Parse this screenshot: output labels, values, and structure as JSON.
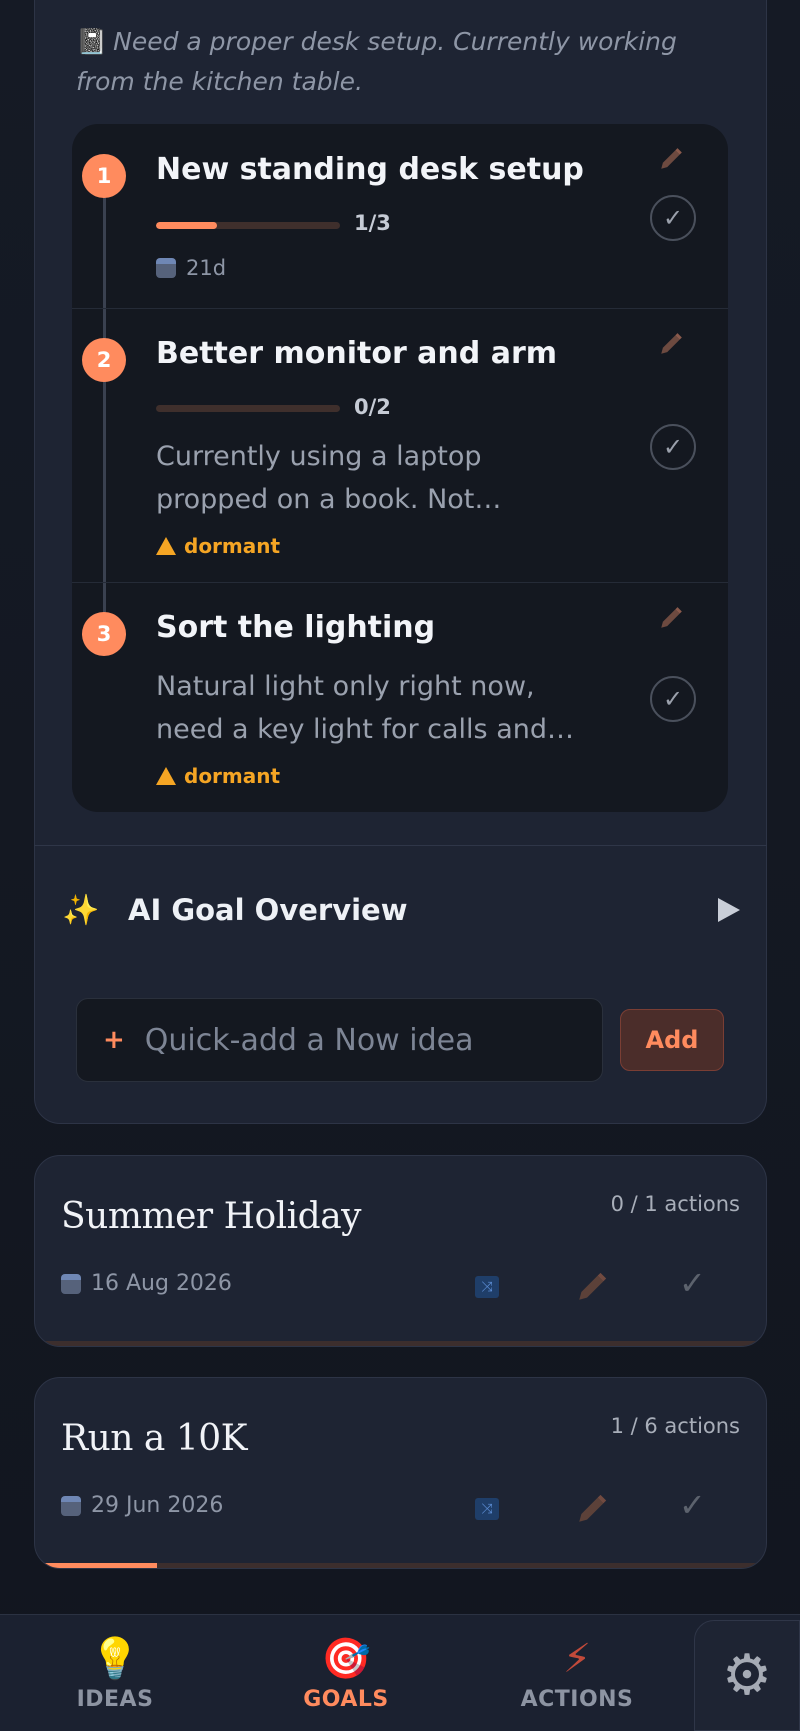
{
  "current_goal": {
    "note_icon": "notebook-icon",
    "note": "Need a proper desk setup. Currently working from the kitchen table.",
    "actions": [
      {
        "step": "1",
        "title": "New standing desk setup",
        "progress_text": "1/3",
        "progress": 0.333,
        "due": "21d"
      },
      {
        "step": "2",
        "title": "Better monitor and arm",
        "progress_text": "0/2",
        "progress": 0,
        "description": "Currently using a laptop propped on a book. Not…",
        "status": "dormant"
      },
      {
        "step": "3",
        "title": "Sort the lighting",
        "description": "Natural light only right now, need a key light for calls and…",
        "status": "dormant"
      }
    ],
    "ai_overview_label": "AI Goal Overview",
    "quick_add": {
      "placeholder": "Quick-add a Now idea",
      "button_label": "Add"
    }
  },
  "goals": [
    {
      "title": "Summer Holiday",
      "actions_count": "0 / 1 actions",
      "date": "16 Aug 2026",
      "progress": 0
    },
    {
      "title": "Run a 10K",
      "actions_count": "1 / 6 actions",
      "date": "29 Jun 2026",
      "progress": 0.1667
    }
  ],
  "nav": {
    "items": [
      {
        "label": "IDEAS",
        "icon": "lightbulb-icon"
      },
      {
        "label": "GOALS",
        "icon": "target-icon",
        "active": true
      },
      {
        "label": "ACTIONS",
        "icon": "lightning-icon"
      }
    ],
    "settings_icon": "gear-icon"
  },
  "colors": {
    "accent": "#ff8b5e",
    "warning": "#f5a524",
    "card": "#1e2433",
    "panel": "#141820"
  }
}
